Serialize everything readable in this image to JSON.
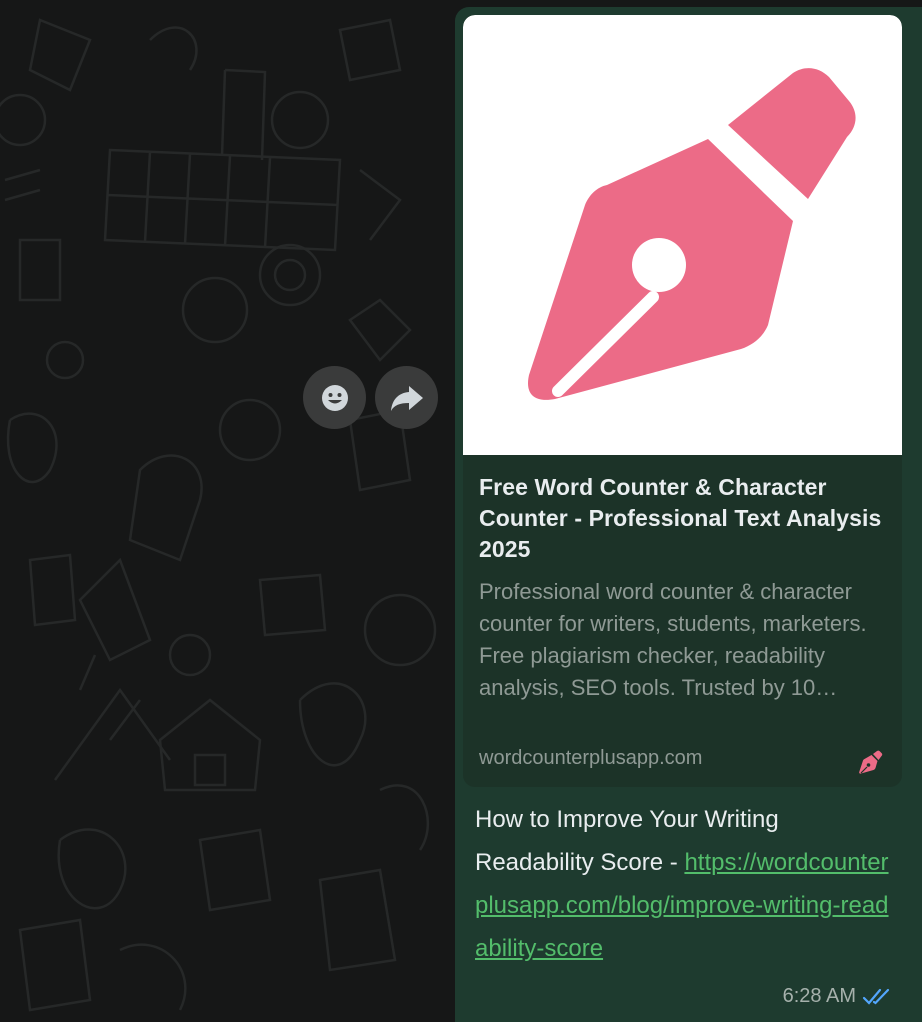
{
  "actions": {
    "react_icon": "smiley-icon",
    "forward_icon": "forward-arrow-icon"
  },
  "link_preview": {
    "title": "Free Word Counter & Character Counter - Professional Text Analysis 2025",
    "description": "Professional word counter & character counter for writers, students, marketers. Free plagiarism checker, readability analysis, SEO tools. Trusted by 10…",
    "domain": "wordcounterplusapp.com",
    "image_icon": "fountain-pen-icon",
    "favicon_icon": "fountain-pen-icon",
    "brand_color": "#ec6b87"
  },
  "message": {
    "text": "How to Improve Your Writing Readability Score - ",
    "link_text": "https://wordcounterplusapp.com/blog/improve-writing-readability-score",
    "time": "6:28 AM",
    "status_icon": "double-check-icon",
    "status_color": "#53a6fd"
  },
  "theme": {
    "bubble_color": "#1e3b2f",
    "link_color": "#53bd6b",
    "background": "#161717"
  }
}
